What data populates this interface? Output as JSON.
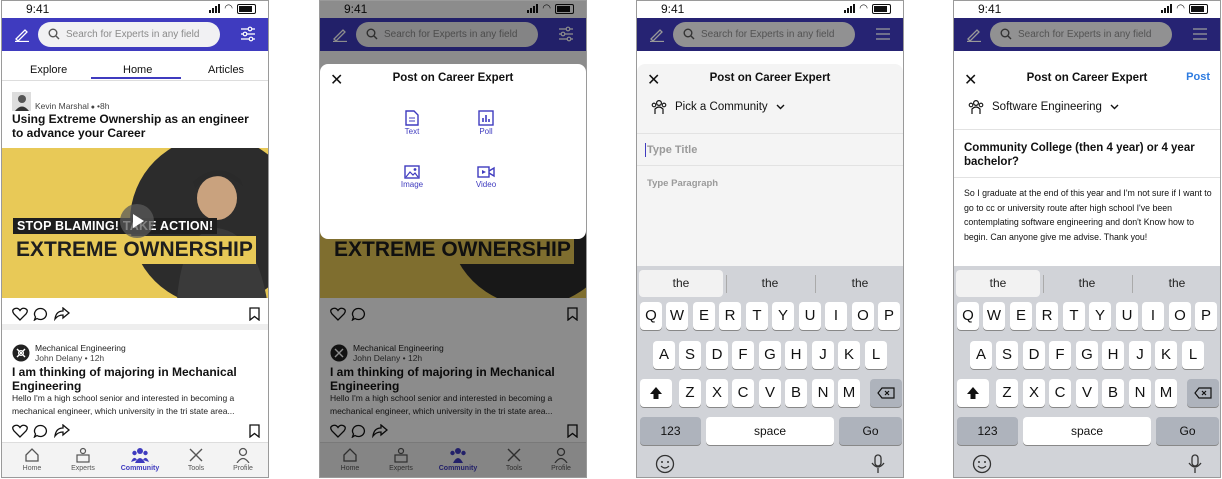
{
  "status": {
    "time": "9:41"
  },
  "search": {
    "placeholder": "Search for Experts in any field"
  },
  "feed": {
    "tabs": [
      "Explore",
      "Home",
      "Articles"
    ],
    "post1": {
      "author": "Kevin Marshal",
      "time": "8h",
      "title": "Using Extreme Ownership as an engineer to advance your Career",
      "banner_line1": "STOP BLAMING! TAKE ACTION!",
      "banner_line2": "EXTREME OWNERSHIP"
    },
    "post2": {
      "community": "Mechanical Engineering",
      "author": "John Delany",
      "time": "12h",
      "title": "I am thinking of majoring in Mechanical Engineering",
      "body": "Hello I'm a high school senior and interested in becoming a mechanical engineer, which university in the tri state area..."
    }
  },
  "nav": {
    "items": [
      "Home",
      "Experts",
      "Community",
      "Tools",
      "Profile"
    ],
    "active": "Community"
  },
  "sheet": {
    "title": "Post on Career Expert",
    "options": [
      "Text",
      "Poll",
      "Image",
      "Video"
    ]
  },
  "compose": {
    "pick_community": "Pick a Community",
    "title_placeholder": "Type Title",
    "paragraph_placeholder": "Type Paragraph",
    "post_label": "Post",
    "community": "Software Engineering",
    "title": "Community College (then 4 year) or 4 year bachelor?",
    "body": "So I graduate at the end of this year and I'm not sure if I want to go to cc or university route after high school I've been contemplating software engineering and don't Know how to begin. Can anyone give me advise. Thank you!"
  },
  "keyboard": {
    "suggestions": [
      "the",
      "the",
      "the"
    ],
    "row1": [
      "Q",
      "W",
      "E",
      "R",
      "T",
      "Y",
      "U",
      "I",
      "O",
      "P"
    ],
    "row2": [
      "A",
      "S",
      "D",
      "F",
      "G",
      "H",
      "J",
      "K",
      "L"
    ],
    "row3": [
      "Z",
      "X",
      "C",
      "V",
      "B",
      "N",
      "M"
    ],
    "numbers": "123",
    "space": "space",
    "go": "Go"
  },
  "colors": {
    "brand": "#3f3bbf",
    "banner": "#e8c957"
  }
}
